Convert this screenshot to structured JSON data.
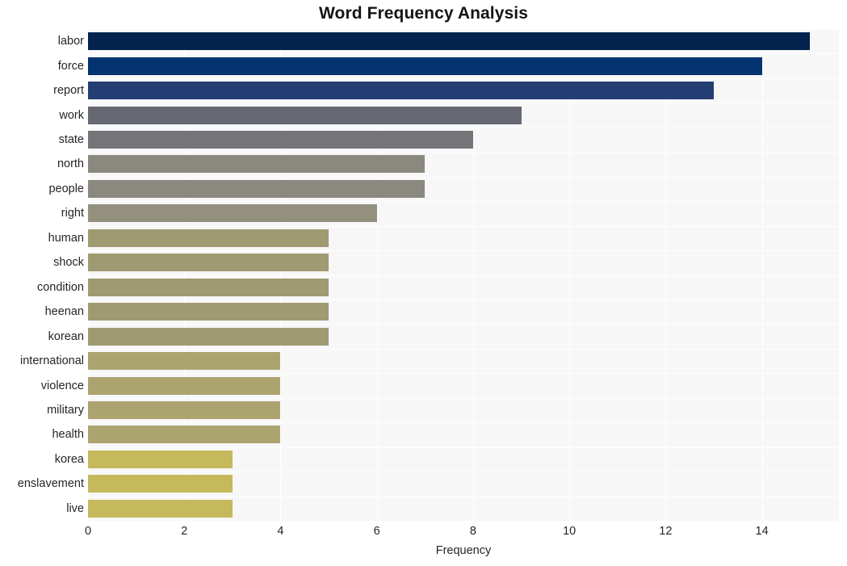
{
  "chart_data": {
    "type": "bar",
    "orientation": "horizontal",
    "title": "Word Frequency Analysis",
    "xlabel": "Frequency",
    "ylabel": "",
    "categories": [
      "labor",
      "force",
      "report",
      "work",
      "state",
      "north",
      "people",
      "right",
      "human",
      "shock",
      "condition",
      "heenan",
      "korean",
      "international",
      "violence",
      "military",
      "health",
      "korea",
      "enslavement",
      "live"
    ],
    "values": [
      15,
      14,
      13,
      9,
      8,
      7,
      7,
      6,
      5,
      5,
      5,
      5,
      5,
      4,
      4,
      4,
      4,
      3,
      3,
      3
    ],
    "bar_colors": [
      "#04244f",
      "#043372",
      "#243d73",
      "#666872",
      "#757579",
      "#8a887f",
      "#8a887f",
      "#93907e",
      "#a09a72",
      "#a09a72",
      "#a09a72",
      "#a09a72",
      "#a09a72",
      "#ab a46f",
      "#aba46f",
      "#aba46f",
      "#aba46f",
      "#c6b85c",
      "#c6b85c",
      "#c6b85c"
    ],
    "xlim": [
      0,
      15.6
    ],
    "xticks": [
      0,
      2,
      4,
      6,
      8,
      10,
      12,
      14
    ],
    "xtick_labels": [
      "0",
      "2",
      "4",
      "6",
      "8",
      "10",
      "12",
      "14"
    ],
    "grid": true,
    "grid_color": "#ffffff",
    "legend": null,
    "plot_background": "#f7f7f8",
    "figure_background": "#ffffff"
  }
}
